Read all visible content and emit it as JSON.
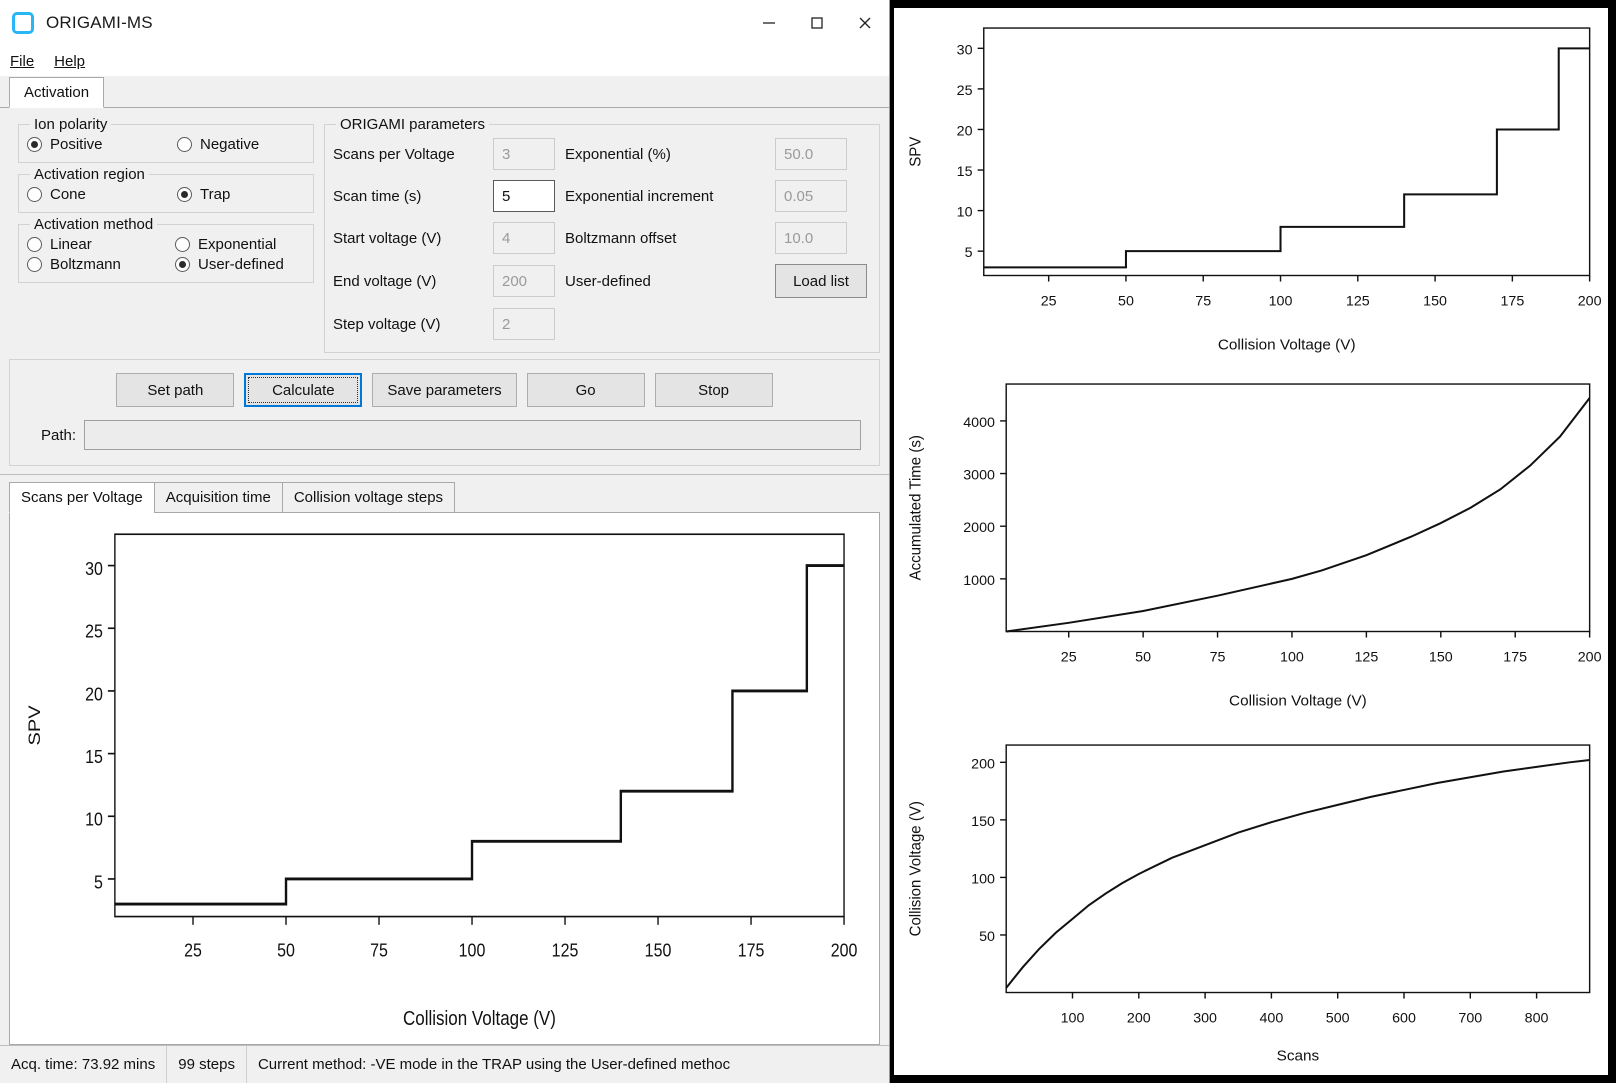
{
  "window": {
    "title": "ORIGAMI-MS",
    "icon": "app-icon",
    "buttons": {
      "minimize": "minimize-icon",
      "maximize": "maximize-icon",
      "close": "close-icon"
    }
  },
  "menubar": {
    "items": [
      {
        "label": "File"
      },
      {
        "label": "Help"
      }
    ]
  },
  "top_tabs": [
    {
      "label": "Activation",
      "active": true
    }
  ],
  "ion_polarity": {
    "legend": "Ion polarity",
    "options": [
      {
        "label": "Positive",
        "selected": true
      },
      {
        "label": "Negative",
        "selected": false
      }
    ]
  },
  "activation_region": {
    "legend": "Activation region",
    "options": [
      {
        "label": "Cone",
        "selected": false
      },
      {
        "label": "Trap",
        "selected": true
      }
    ]
  },
  "activation_method": {
    "legend": "Activation method",
    "options": [
      {
        "label": "Linear",
        "selected": false
      },
      {
        "label": "Exponential",
        "selected": false
      },
      {
        "label": "Boltzmann",
        "selected": false
      },
      {
        "label": "User-defined",
        "selected": true
      }
    ]
  },
  "origami_parameters": {
    "legend": "ORIGAMI parameters",
    "fields": [
      {
        "label": "Scans per Voltage",
        "value": "3",
        "enabled": false
      },
      {
        "label": "Exponential (%)",
        "value": "50.0",
        "enabled": false
      },
      {
        "label": "Scan time (s)",
        "value": "5",
        "enabled": true
      },
      {
        "label": "Exponential increment",
        "value": "0.05",
        "enabled": false
      },
      {
        "label": "Start voltage (V)",
        "value": "4",
        "enabled": false
      },
      {
        "label": "Boltzmann offset",
        "value": "10.0",
        "enabled": false
      },
      {
        "label": "End voltage (V)",
        "value": "200",
        "enabled": false
      },
      {
        "label": "Step voltage (V)",
        "value": "2",
        "enabled": false
      }
    ],
    "user_defined_label": "User-defined",
    "load_list_label": "Load list"
  },
  "actions": {
    "buttons": [
      {
        "label": "Set path",
        "focused": false
      },
      {
        "label": "Calculate",
        "focused": true
      },
      {
        "label": "Save parameters",
        "focused": false
      },
      {
        "label": "Go",
        "focused": false
      },
      {
        "label": "Stop",
        "focused": false
      }
    ],
    "path_label": "Path:",
    "path_value": "",
    "path_placeholder": ""
  },
  "plot_tabs": [
    {
      "label": "Scans per Voltage",
      "active": true
    },
    {
      "label": "Acquisition time",
      "active": false
    },
    {
      "label": "Collision voltage steps",
      "active": false
    }
  ],
  "statusbar": {
    "acq_time": "Acq. time: 73.92 mins",
    "steps": "99 steps",
    "method": "Current method: -VE mode in the TRAP using the User-defined methoc"
  },
  "colors": {
    "accent": "#0078d7",
    "icon": "#29b6f6",
    "window_bg": "#f0f0f0",
    "plot_line": "#111111",
    "panel_frame": "#000000"
  },
  "chart_data": [
    {
      "id": "scans-per-voltage",
      "type": "line",
      "title": "",
      "xlabel": "Collision Voltage (V)",
      "ylabel": "SPV",
      "xlim": [
        4,
        200
      ],
      "ylim": [
        2.0,
        32.5
      ],
      "xticks": [
        25,
        50,
        75,
        100,
        125,
        150,
        175,
        200
      ],
      "yticks": [
        5,
        10,
        15,
        20,
        25,
        30
      ],
      "grid": false,
      "step_style": "post",
      "x": [
        4,
        50,
        50,
        100,
        100,
        140,
        140,
        170,
        170,
        190,
        190,
        200
      ],
      "y": [
        3,
        3,
        5,
        5,
        8,
        8,
        12,
        12,
        20,
        20,
        30,
        30
      ],
      "segments": [
        {
          "voltage_from": 4,
          "voltage_to": 50,
          "spv": 3
        },
        {
          "voltage_from": 50,
          "voltage_to": 100,
          "spv": 5
        },
        {
          "voltage_from": 100,
          "voltage_to": 140,
          "spv": 8
        },
        {
          "voltage_from": 140,
          "voltage_to": 170,
          "spv": 12
        },
        {
          "voltage_from": 170,
          "voltage_to": 190,
          "spv": 20
        },
        {
          "voltage_from": 190,
          "voltage_to": 200,
          "spv": 30
        }
      ]
    },
    {
      "id": "accumulated-time",
      "type": "line",
      "title": "",
      "xlabel": "Collision Voltage (V)",
      "ylabel": "Accumulated Time (s)",
      "xlim": [
        4,
        200
      ],
      "ylim": [
        0,
        4700
      ],
      "xticks": [
        25,
        50,
        75,
        100,
        125,
        150,
        175,
        200
      ],
      "yticks": [
        1000,
        2000,
        3000,
        4000
      ],
      "grid": false,
      "x": [
        4,
        25,
        50,
        75,
        100,
        110,
        125,
        140,
        150,
        160,
        170,
        180,
        190,
        200
      ],
      "y": [
        0,
        165,
        390,
        680,
        1000,
        1160,
        1450,
        1800,
        2060,
        2350,
        2700,
        3150,
        3700,
        4435
      ]
    },
    {
      "id": "collision-voltage-steps",
      "type": "line",
      "title": "",
      "xlabel": "Scans",
      "ylabel": "Collision Voltage (V)",
      "xlim": [
        0,
        880
      ],
      "ylim": [
        0,
        215
      ],
      "xticks": [
        100,
        200,
        300,
        400,
        500,
        600,
        700,
        800
      ],
      "yticks": [
        50,
        100,
        150,
        200
      ],
      "grid": false,
      "x": [
        0,
        25,
        50,
        75,
        100,
        125,
        150,
        175,
        200,
        250,
        300,
        350,
        400,
        450,
        500,
        550,
        600,
        650,
        700,
        750,
        800,
        850,
        880
      ],
      "y": [
        4,
        22,
        38,
        52,
        64,
        76,
        86,
        95,
        103,
        117,
        128,
        139,
        148,
        156,
        163,
        170,
        176,
        182,
        187,
        192,
        196,
        200,
        202
      ]
    }
  ]
}
